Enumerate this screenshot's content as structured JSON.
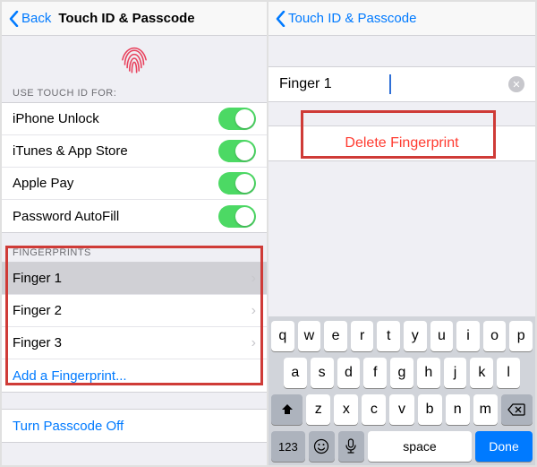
{
  "left": {
    "nav": {
      "back": "Back",
      "title": "Touch ID & Passcode"
    },
    "section_use": "USE TOUCH ID FOR:",
    "toggles": [
      {
        "label": "iPhone Unlock"
      },
      {
        "label": "iTunes & App Store"
      },
      {
        "label": "Apple Pay"
      },
      {
        "label": "Password AutoFill"
      }
    ],
    "section_fp": "FINGERPRINTS",
    "fingers": [
      {
        "label": "Finger 1"
      },
      {
        "label": "Finger 2"
      },
      {
        "label": "Finger 3"
      }
    ],
    "add_fp": "Add a Fingerprint...",
    "turn_off": "Turn Passcode Off"
  },
  "right": {
    "nav": {
      "back": "Touch ID & Passcode"
    },
    "input_value": "Finger 1",
    "delete_label": "Delete Fingerprint"
  },
  "kbd": {
    "r1": [
      "q",
      "w",
      "e",
      "r",
      "t",
      "y",
      "u",
      "i",
      "o",
      "p"
    ],
    "r2": [
      "a",
      "s",
      "d",
      "f",
      "g",
      "h",
      "j",
      "k",
      "l"
    ],
    "r3": [
      "z",
      "x",
      "c",
      "v",
      "b",
      "n",
      "m"
    ],
    "num": "123",
    "space": "space",
    "done": "Done"
  }
}
